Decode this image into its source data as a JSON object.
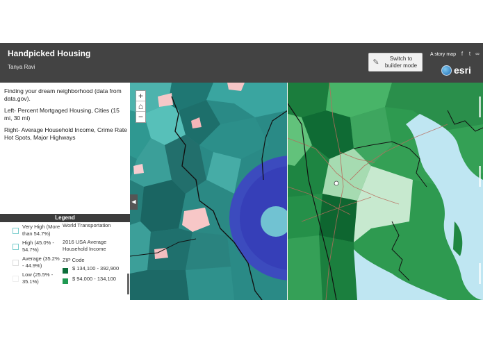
{
  "header": {
    "title": "Handpicked Housing",
    "author": "Tanya Ravi",
    "builder_button": "Switch to builder mode",
    "story_map": "A story map",
    "brand": "esri",
    "share_icons": [
      "facebook-icon",
      "twitter-icon",
      "link-icon"
    ]
  },
  "description": {
    "line1": "Finding your dream neighborhood (data from data.gov).",
    "line2": "Left- Percent Mortgaged Housing, Cities (15 mi, 30 mi)",
    "line3": "Right- Average Household Income, Crime Rate Hot Spots, Major Highways"
  },
  "legend": {
    "title": "Legend",
    "items": [
      {
        "label": "Very High (More than 54.7%)",
        "color": "#ffffff"
      },
      {
        "label": "High (45.0% - 54.7%)",
        "color": "#ffffff"
      },
      {
        "label": "Average (35.2% - 44.9%)",
        "color": "#ffffff"
      },
      {
        "label": "Low (25.5% - 35.1%)",
        "color": "#ffffff"
      }
    ],
    "right_heading1": "World Transportation",
    "right_heading2": "2016 USA Average Household Income",
    "right_heading3": "ZIP Code",
    "income_items": [
      {
        "label": "$ 134,100 - 392,900",
        "color": "#0d6e3a"
      },
      {
        "label": "$ 94,000 - 134,100",
        "color": "#1f9a52"
      }
    ]
  },
  "map": {
    "zoom_in": "+",
    "home": "⌂",
    "zoom_out": "−",
    "collapse": "◀",
    "left_base_color": "#2a8a86",
    "right_base_color": "#2e9a50",
    "water_color": "#bfe6f2",
    "buffer_outer": "#3f3fc8",
    "buffer_inner": "#7bd9d6"
  }
}
